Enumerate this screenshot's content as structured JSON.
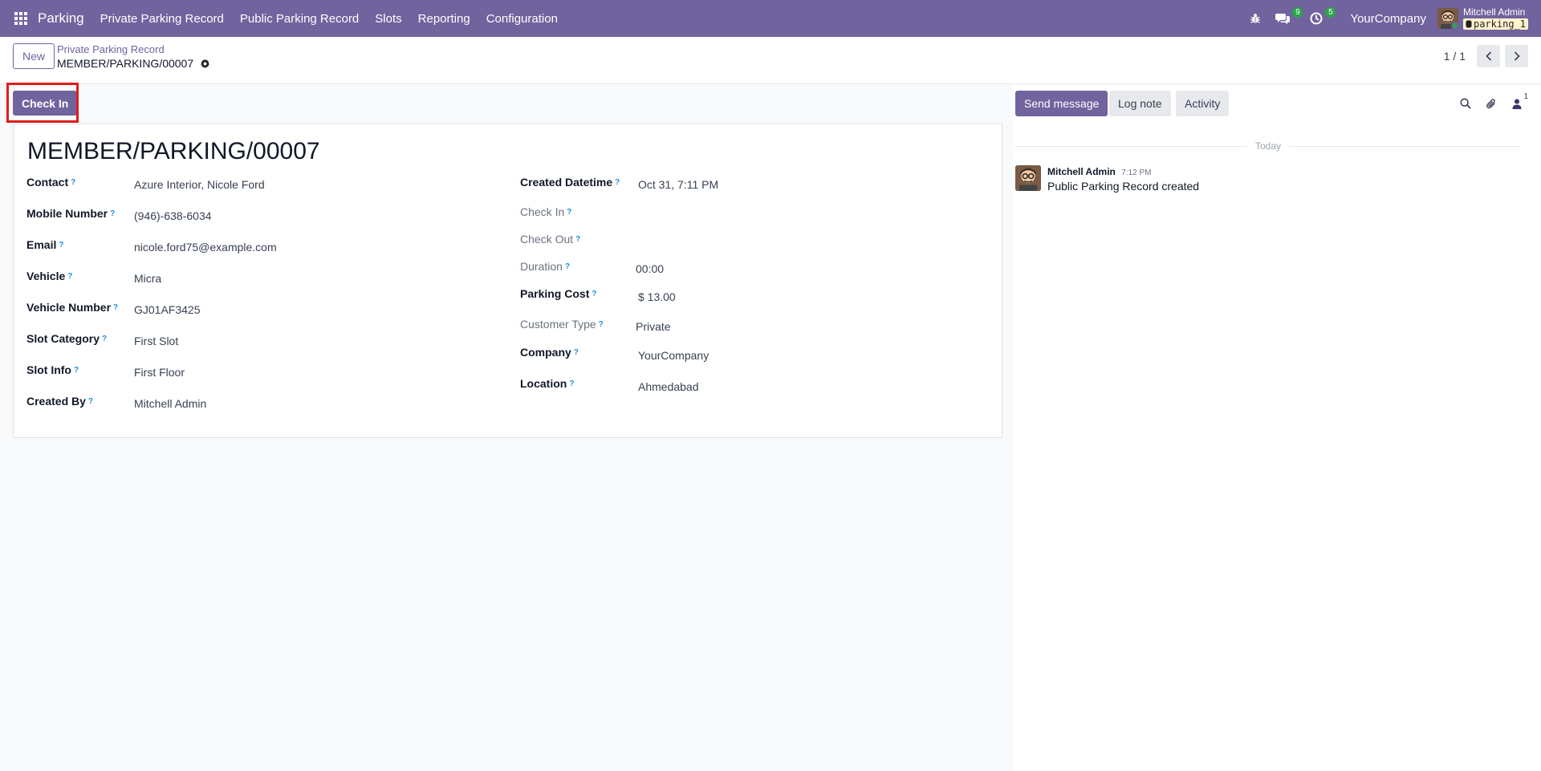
{
  "nav": {
    "app_name": "Parking",
    "menus": [
      "Private Parking Record",
      "Public Parking Record",
      "Slots",
      "Reporting",
      "Configuration"
    ],
    "messages_count": "9",
    "activities_count": "5",
    "company": "YourCompany",
    "user_name": "Mitchell Admin",
    "database": "parking_1",
    "icons": [
      "apps-grid-icon",
      "bug-icon",
      "chat-bubbles-icon",
      "clock-icon",
      "database-icon"
    ]
  },
  "control": {
    "new_label": "New",
    "breadcrumb_parent": "Private Parking Record",
    "breadcrumb_current": "MEMBER/PARKING/00007",
    "pager": "1 / 1"
  },
  "status": {
    "check_in_label": "Check In"
  },
  "record": {
    "title": "MEMBER/PARKING/00007",
    "left_fields": [
      {
        "label": "Contact",
        "value": "Azure Interior, Nicole Ford"
      },
      {
        "label": "Mobile Number",
        "value": "(946)-638-6034"
      },
      {
        "label": "Email",
        "value": "nicole.ford75@example.com"
      },
      {
        "label": "Vehicle",
        "value": "Micra"
      },
      {
        "label": "Vehicle Number",
        "value": "GJ01AF3425"
      },
      {
        "label": "Slot Category",
        "value": "First Slot"
      },
      {
        "label": "Slot Info",
        "value": "First Floor"
      },
      {
        "label": "Created By",
        "value": "Mitchell Admin"
      }
    ],
    "right_fields": [
      {
        "label": "Created Datetime",
        "value": "Oct 31, 7:11 PM"
      },
      {
        "label": "Check In",
        "value": ""
      },
      {
        "label": "Check Out",
        "value": ""
      },
      {
        "label": "Duration",
        "value": "00:00"
      },
      {
        "label": "Parking Cost",
        "value": "$ 13.00"
      },
      {
        "label": "Customer Type",
        "value": "Private"
      },
      {
        "label": "Company",
        "value": "YourCompany"
      },
      {
        "label": "Location",
        "value": "Ahmedabad"
      }
    ],
    "help_mark": "?"
  },
  "chatter": {
    "send_message": "Send message",
    "log_note": "Log note",
    "activity": "Activity",
    "followers_count": "1",
    "date_separator": "Today",
    "messages": [
      {
        "author": "Mitchell Admin",
        "time": "7:12 PM",
        "text": "Public Parking Record created"
      }
    ]
  },
  "colors": {
    "brand": "#71639e",
    "badge": "#28a745",
    "highlight": "#e31b1b",
    "help": "#1c8ee0"
  }
}
